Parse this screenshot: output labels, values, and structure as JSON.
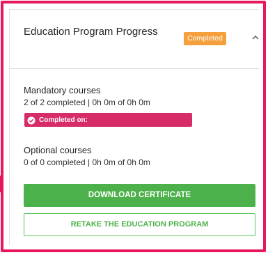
{
  "header": {
    "title": "Education Program Progress",
    "status_badge": "Completed",
    "collapse_icon": "chevron-up-icon"
  },
  "mandatory": {
    "title": "Mandatory courses",
    "summary": "2 of 2 completed | 0h 0m of 0h 0m",
    "completed_label": "Completed on:",
    "completed_icon": "check-circle-icon"
  },
  "optional": {
    "title": "Optional courses",
    "summary": "0 of 0 completed | 0h 0m of 0h 0m"
  },
  "actions": {
    "download_label": "DOWNLOAD CERTIFICATE",
    "retake_label": "RETAKE THE EDUCATION PROGRAM"
  },
  "colors": {
    "highlight_border": "#e8175d",
    "badge": "#f5a03c",
    "completed_bar": "#d82b6a",
    "primary_green": "#4cb14a"
  }
}
